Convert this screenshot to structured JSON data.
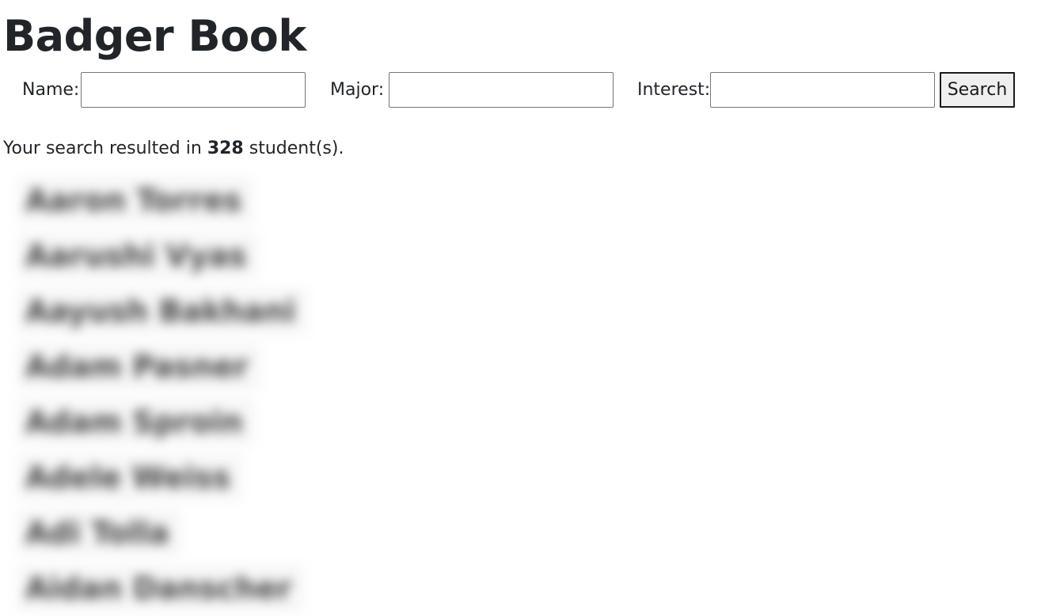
{
  "app": {
    "title": "Badger Book"
  },
  "search": {
    "name_label": "Name:",
    "name_value": "",
    "major_label": "Major:",
    "major_value": "",
    "interest_label": "Interest:",
    "interest_value": "",
    "button_label": "Search"
  },
  "results": {
    "prefix": "Your search resulted in ",
    "count": "328",
    "suffix": " student(s)."
  },
  "students": [
    {
      "name": "Aaron Torres"
    },
    {
      "name": "Aarushi Vyas"
    },
    {
      "name": "Aayush Bakhani"
    },
    {
      "name": "Adam Pasner"
    },
    {
      "name": "Adam Sproin"
    },
    {
      "name": "Adele Weiss"
    },
    {
      "name": "Adi Tolla"
    },
    {
      "name": "Aidan Danscher"
    }
  ]
}
